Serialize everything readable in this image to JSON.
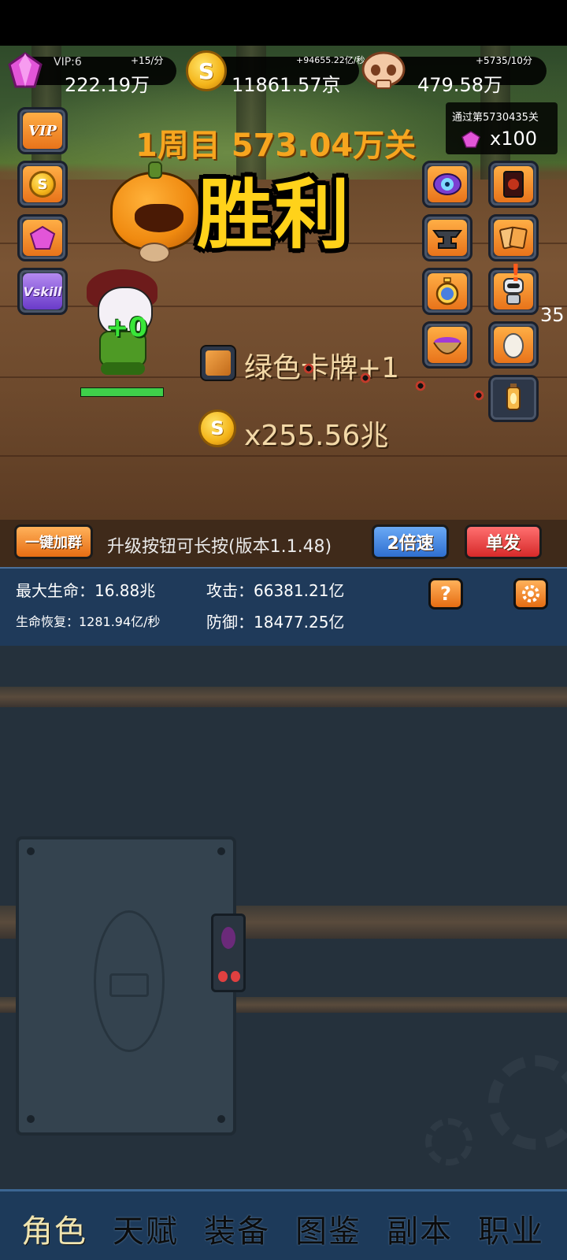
{
  "resources": {
    "vip_label": "VIP:6",
    "gems": {
      "value": "222.19万",
      "rate": "+15/分",
      "icon": "gem-icon"
    },
    "coins": {
      "value": "11861.57京",
      "rate": "+94655.22亿/秒",
      "icon": "coin-icon"
    },
    "skulls": {
      "value": "479.58万",
      "rate": "+5735/10分",
      "icon": "skull-icon"
    }
  },
  "stage": {
    "title": "1周目 573.04万关",
    "passed_label": "通过第5730435关",
    "reward_count": "x100"
  },
  "battle": {
    "victory_text": "胜利",
    "hero_damage": "+0",
    "hero_hp": 1.0,
    "loot_card_text": "绿色卡牌+1",
    "loot_coin_text": "x255.56兆",
    "edge_number": "35"
  },
  "left_buttons": [
    {
      "label": "VIP",
      "icon": "vip-icon"
    },
    {
      "label": "S",
      "icon": "coin-icon"
    },
    {
      "label": "",
      "icon": "gem-icon"
    },
    {
      "label": "Vskill",
      "icon": "vskill-icon"
    }
  ],
  "right_buttons": [
    {
      "icon": "eye-monster-icon"
    },
    {
      "icon": "dark-card-icon"
    },
    {
      "icon": "anvil-icon"
    },
    {
      "icon": "card-pack-icon"
    },
    {
      "icon": "stopwatch-icon"
    },
    {
      "icon": "robot-icon"
    },
    {
      "icon": "potion-bowl-icon"
    },
    {
      "icon": "egg-icon"
    },
    {
      "icon": "lantern-icon"
    }
  ],
  "actionbar": {
    "join_group": "一键加群",
    "version_text": "升级按钮可长按(版本1.1.48)",
    "speed": "2倍速",
    "fire_mode": "单发"
  },
  "stats": {
    "max_hp": "最大生命：16.88兆",
    "attack": "攻击：66381.21亿",
    "regen": "生命恢复：1281.94亿/秒",
    "defense": "防御：18477.25亿",
    "help": "?"
  },
  "nav": {
    "items": [
      "角色",
      "天赋",
      "装备",
      "图鉴",
      "副本",
      "职业"
    ],
    "active": 0
  },
  "colors": {
    "accent_orange": "#f7a51f",
    "victory_yellow": "#ffd21a",
    "panel_blue": "#1f3a5a",
    "gem_pink": "#e255d8"
  }
}
